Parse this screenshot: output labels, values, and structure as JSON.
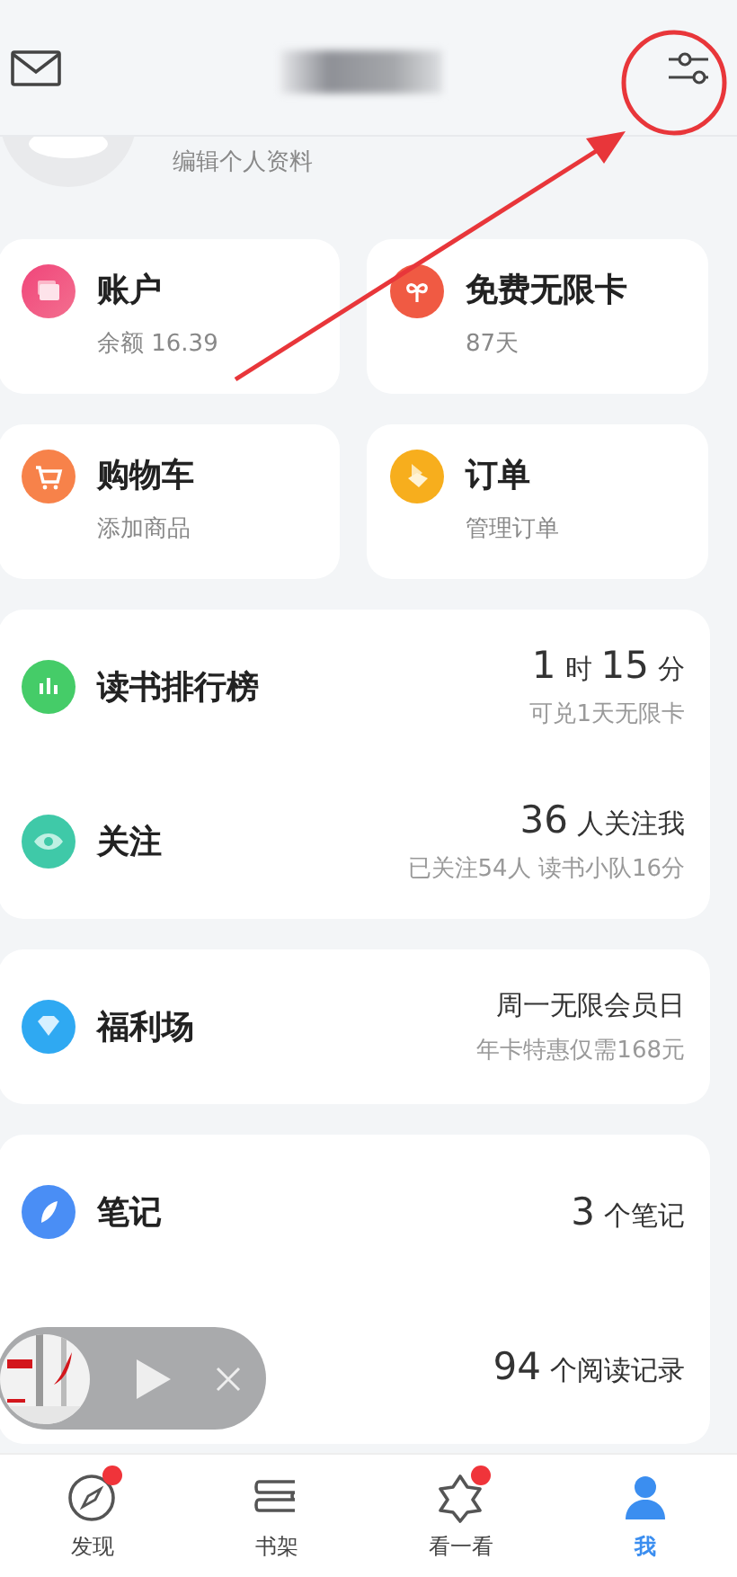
{
  "profile": {
    "edit_link": "编辑个人资料"
  },
  "tiles": [
    {
      "kind": "account",
      "title": "账户",
      "subtitle": "余额 16.39"
    },
    {
      "kind": "card",
      "title": "免费无限卡",
      "subtitle": "87天"
    },
    {
      "kind": "cart",
      "title": "购物车",
      "subtitle": "添加商品"
    },
    {
      "kind": "order",
      "title": "订单",
      "subtitle": "管理订单"
    }
  ],
  "groups": [
    {
      "rows": [
        {
          "kind": "rank",
          "title": "读书排行榜",
          "value": [
            {
              "kind": "number",
              "text": "1"
            },
            {
              "kind": "unit",
              "text": "时"
            },
            {
              "kind": "number",
              "text": "15"
            },
            {
              "kind": "unit",
              "text": "分"
            }
          ],
          "note": "可兑1天无限卡"
        },
        {
          "kind": "follow",
          "title": "关注",
          "value": [
            {
              "kind": "number",
              "text": "36"
            },
            {
              "kind": "unit",
              "text": "人关注我"
            }
          ],
          "note": "已关注54人 读书小队16分"
        }
      ]
    },
    {
      "rows": [
        {
          "kind": "welfare",
          "title": "福利场",
          "value": [
            {
              "kind": "unit",
              "text": "周一无限会员日"
            }
          ],
          "note": "年卡特惠仅需168元"
        }
      ]
    },
    {
      "rows": [
        {
          "kind": "notes",
          "title": "笔记",
          "value": [
            {
              "kind": "number",
              "text": "3"
            },
            {
              "kind": "unit",
              "text": "个笔记"
            }
          ]
        },
        {
          "kind": "history",
          "value": [
            {
              "kind": "number",
              "text": "94"
            },
            {
              "kind": "unit",
              "text": "个阅读记录"
            }
          ]
        }
      ]
    }
  ],
  "tabs": [
    {
      "kind": "discover",
      "label": "发现",
      "selected": false,
      "dot": true
    },
    {
      "kind": "shelf",
      "label": "书架",
      "selected": false,
      "dot": false
    },
    {
      "kind": "look",
      "label": "看一看",
      "selected": false,
      "dot": true
    },
    {
      "kind": "me",
      "label": "我",
      "selected": true,
      "dot": false
    }
  ]
}
